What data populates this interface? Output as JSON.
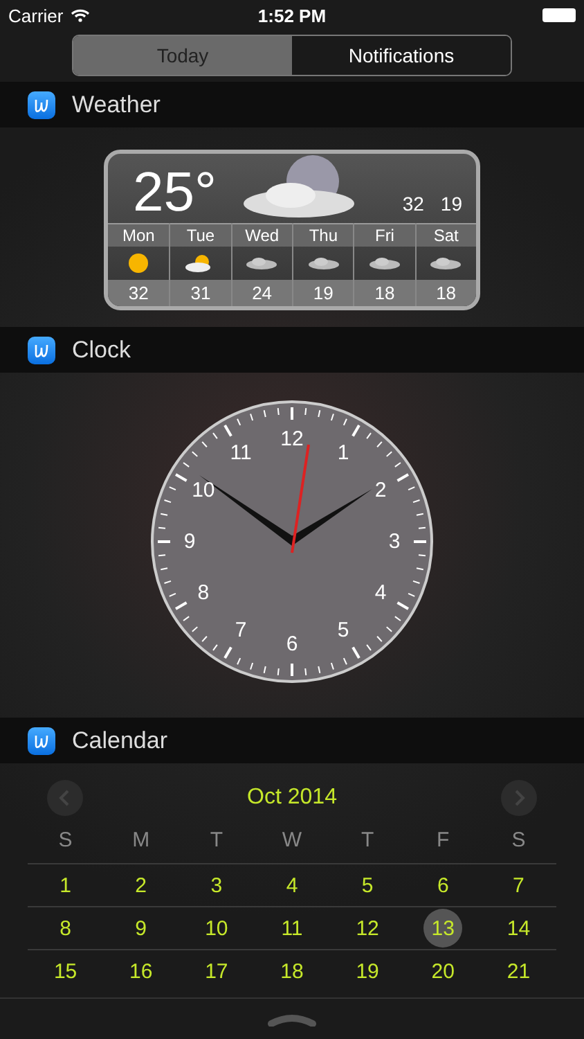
{
  "status_bar": {
    "carrier": "Carrier",
    "time": "1:52 PM"
  },
  "tabs": [
    {
      "label": "Today",
      "selected": true
    },
    {
      "label": "Notifications",
      "selected": false
    }
  ],
  "widgets": [
    {
      "kind": "weather",
      "title": "Weather",
      "current": "25°",
      "high": "32",
      "low": "19",
      "days": [
        {
          "name": "Mon",
          "kind": "sun",
          "temp": "32"
        },
        {
          "name": "Tue",
          "kind": "partly",
          "temp": "31"
        },
        {
          "name": "Wed",
          "kind": "cloud",
          "temp": "24"
        },
        {
          "name": "Thu",
          "kind": "cloud",
          "temp": "19"
        },
        {
          "name": "Fri",
          "kind": "cloud",
          "temp": "18"
        },
        {
          "name": "Sat",
          "kind": "cloud",
          "temp": "18"
        }
      ]
    },
    {
      "kind": "clock",
      "title": "Clock",
      "numerals": [
        "12",
        "1",
        "2",
        "3",
        "4",
        "5",
        "6",
        "7",
        "8",
        "9",
        "10",
        "11"
      ]
    },
    {
      "kind": "calendar",
      "title": "Calendar",
      "month": "Oct 2014",
      "weekdays": [
        "S",
        "M",
        "T",
        "W",
        "T",
        "F",
        "S"
      ],
      "weeks": [
        [
          {
            "day": "1",
            "selected": false
          },
          {
            "day": "2",
            "selected": false
          },
          {
            "day": "3",
            "selected": false
          },
          {
            "day": "4",
            "selected": false
          },
          {
            "day": "5",
            "selected": false
          },
          {
            "day": "6",
            "selected": false
          },
          {
            "day": "7",
            "selected": false
          }
        ],
        [
          {
            "day": "8",
            "selected": false
          },
          {
            "day": "9",
            "selected": false
          },
          {
            "day": "10",
            "selected": false
          },
          {
            "day": "11",
            "selected": false
          },
          {
            "day": "12",
            "selected": false
          },
          {
            "day": "13",
            "selected": true
          },
          {
            "day": "14",
            "selected": false
          }
        ],
        [
          {
            "day": "15",
            "selected": false
          },
          {
            "day": "16",
            "selected": false
          },
          {
            "day": "17",
            "selected": false
          },
          {
            "day": "18",
            "selected": false
          },
          {
            "day": "19",
            "selected": false
          },
          {
            "day": "20",
            "selected": false
          },
          {
            "day": "21",
            "selected": false
          }
        ]
      ]
    }
  ]
}
